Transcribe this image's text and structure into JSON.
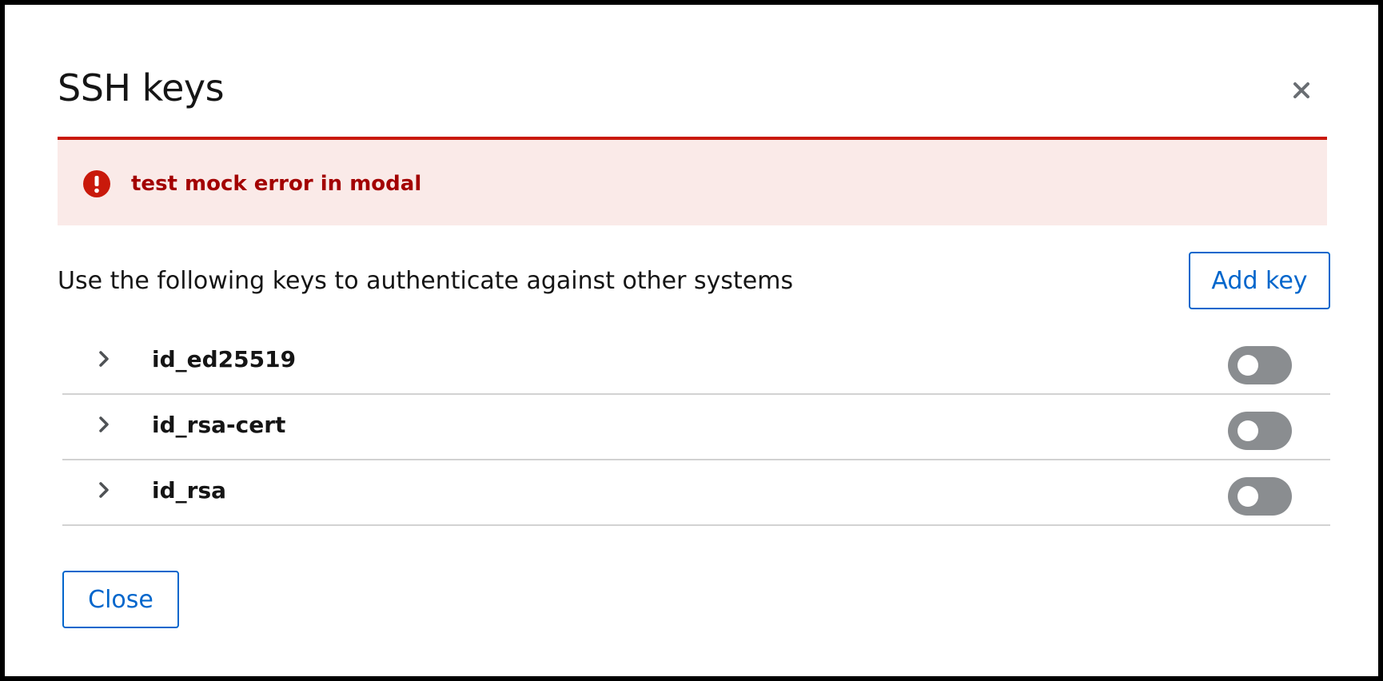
{
  "modal": {
    "title": "SSH keys",
    "close_icon": "close-icon"
  },
  "alert": {
    "variant": "danger",
    "icon": "exclamation-circle-icon",
    "title": "test mock error in modal",
    "colors": {
      "border": "#c9190b",
      "background": "#faeae8",
      "text": "#a30000"
    }
  },
  "description": "Use the following keys to authenticate against other systems",
  "add_key_label": "Add key",
  "keys": [
    {
      "name": "id_ed25519",
      "enabled": false
    },
    {
      "name": "id_rsa-cert",
      "enabled": false
    },
    {
      "name": "id_rsa",
      "enabled": false
    }
  ],
  "footer": {
    "close_label": "Close"
  },
  "colors": {
    "accent": "#0066cc",
    "toggle_off": "#8a8d90"
  }
}
